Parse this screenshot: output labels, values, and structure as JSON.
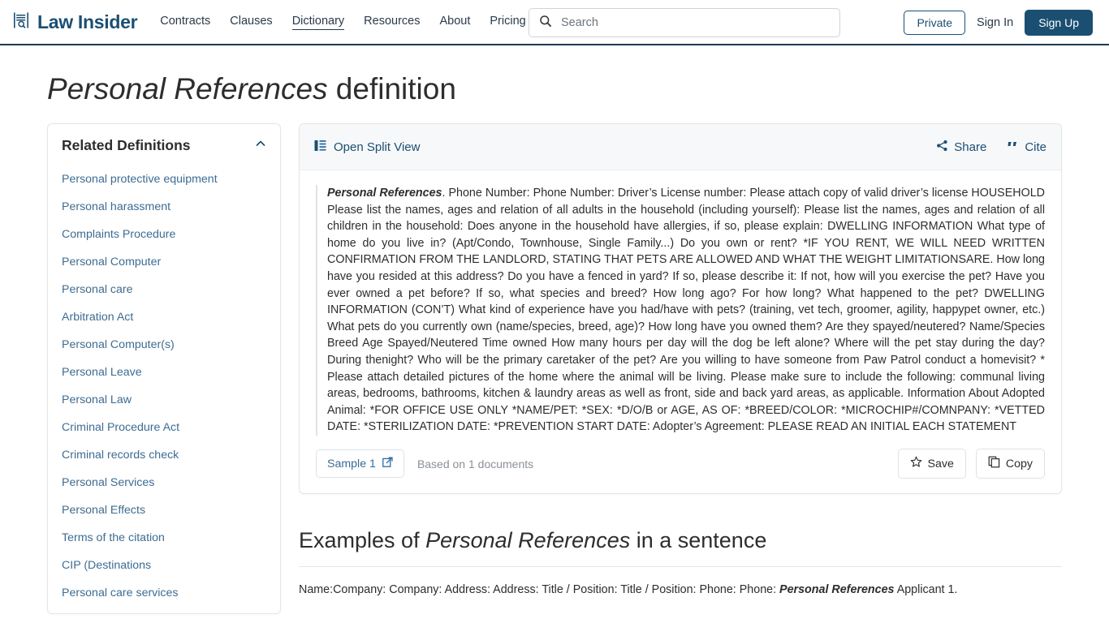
{
  "header": {
    "brand": "Law Insider",
    "brand_icon": "document-search-icon",
    "nav": [
      {
        "label": "Contracts",
        "active": false
      },
      {
        "label": "Clauses",
        "active": false
      },
      {
        "label": "Dictionary",
        "active": true
      },
      {
        "label": "Resources",
        "active": false
      },
      {
        "label": "About",
        "active": false
      },
      {
        "label": "Pricing",
        "active": false
      }
    ],
    "search": {
      "placeholder": "Search",
      "value": "",
      "icon": "search-icon"
    },
    "private_label": "Private",
    "signin_label": "Sign In",
    "signup_label": "Sign Up",
    "accent_color": "#1b4f72",
    "border_color": "#1b3a57"
  },
  "page": {
    "title_term": "Personal References",
    "title_suffix": " definition"
  },
  "sidebar": {
    "title": "Related Definitions",
    "collapse_icon": "chevron-up-icon",
    "items": [
      {
        "label": "Personal protective equipment"
      },
      {
        "label": "Personal harassment"
      },
      {
        "label": "Complaints Procedure"
      },
      {
        "label": "Personal Computer"
      },
      {
        "label": "Personal care"
      },
      {
        "label": "Arbitration Act"
      },
      {
        "label": "Personal Computer(s)"
      },
      {
        "label": "Personal Leave"
      },
      {
        "label": "Personal Law"
      },
      {
        "label": "Criminal Procedure Act"
      },
      {
        "label": "Criminal records check"
      },
      {
        "label": "Personal Services"
      },
      {
        "label": "Personal Effects"
      },
      {
        "label": "Terms of the citation"
      },
      {
        "label": "CIP (Destinations"
      },
      {
        "label": "Personal care services"
      }
    ]
  },
  "definition_card": {
    "toolbar": {
      "split_view_label": "Open Split View",
      "split_view_icon": "split-view-icon",
      "share_label": "Share",
      "share_icon": "share-icon",
      "cite_label": "Cite",
      "cite_icon": "quote-icon"
    },
    "term": "Personal References",
    "body": ". Phone Number: Phone Number: Driver’s License number: Please attach copy of valid driver’s license HOUSEHOLD Please list the names, ages and relation of all adults in the household (including yourself): Please list the names, ages and relation of all children in the household: Does anyone in the household have allergies, if so, please explain: DWELLING INFORMATION What type of home do you live in? (Apt/Condo, Townhouse, Single Family...) Do you own or rent? *IF YOU RENT, WE WILL NEED WRITTEN CONFIRMATION FROM THE LANDLORD, STATING THAT PETS ARE ALLOWED AND WHAT THE WEIGHT LIMITATIONSARE. How long have you resided at this address? Do you have a fenced in yard? If so, please describe it: If not, how will you exercise the pet? Have you ever owned a pet before? If so, what species and breed? How long ago? For how long? What happened to the pet? DWELLING INFORMATION (CON’T) What kind of experience have you had/have with pets? (training, vet tech, groomer, agility, happypet owner, etc.) What pets do you currently own (name/species, breed, age)? How long have you owned them? Are they spayed/neutered? Name/Species Breed Age Spayed/Neutered Time owned How many hours per day will the dog be left alone? Where will the pet stay during the day? During thenight? Who will be the primary caretaker of the pet? Are you willing to have someone from Paw Patrol conduct a homevisit? * Please attach detailed pictures of the home where the animal will be living. Please make sure to include the following: communal living areas, bedrooms, bathrooms, kitchen & laundry areas as well as front, side and back yard areas, as applicable. Information About Adopted Animal: *FOR OFFICE USE ONLY *NAME/PET: *SEX: *D/O/B or AGE, AS OF: *BREED/COLOR: *MICROCHIP#/COMNPANY: *VETTED DATE: *STERILIZATION DATE: *PREVENTION START DATE: Adopter’s Agreement: PLEASE READ AN INITIAL EACH STATEMENT",
    "footer": {
      "sample_label": "Sample 1",
      "sample_icon": "external-link-icon",
      "based_on": "Based on 1 documents",
      "save_label": "Save",
      "save_icon": "star-icon",
      "copy_label": "Copy",
      "copy_icon": "copy-icon"
    }
  },
  "examples": {
    "title_prefix": "Examples of ",
    "title_term": "Personal References",
    "title_suffix": " in a sentence",
    "items": [
      {
        "before": "Name:Company: Company: Address: Address: Title / Position: Title / Position: Phone: Phone: ",
        "term": "Personal References",
        "after": " Applicant 1."
      }
    ]
  }
}
